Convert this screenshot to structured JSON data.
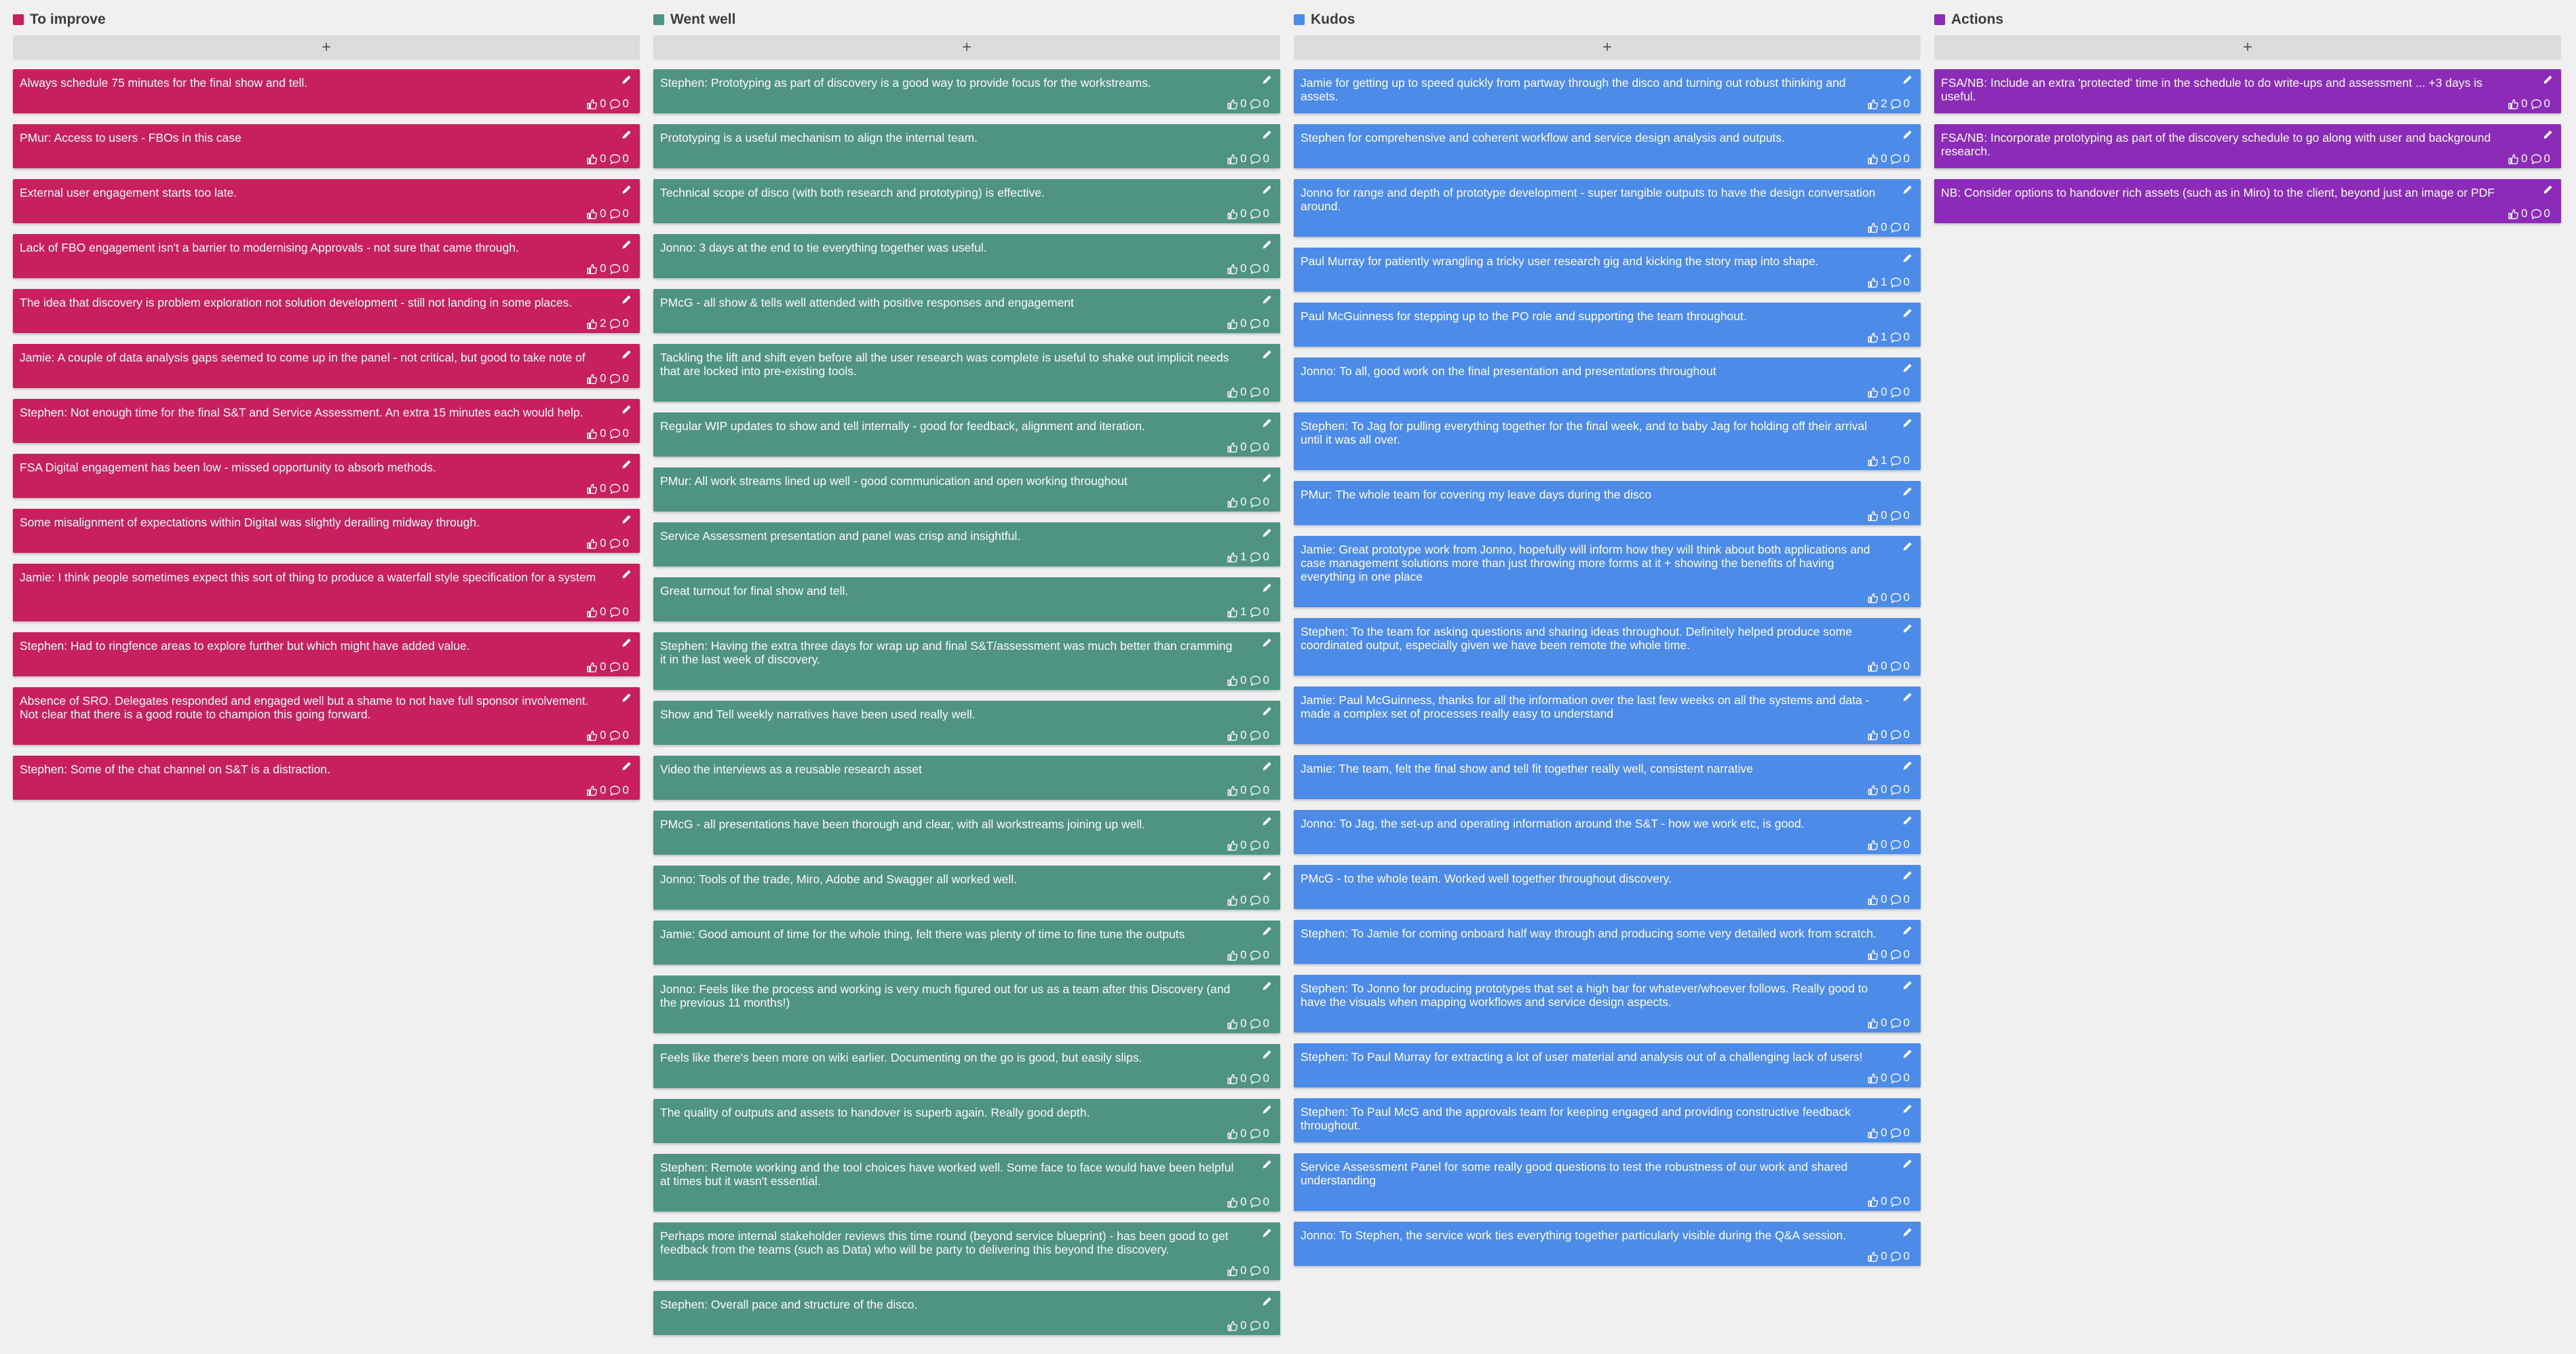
{
  "colors": {
    "background": "#f0f0f0",
    "add_button": "#dcdcdc"
  },
  "add_label": "+",
  "columns": [
    {
      "title": "To improve",
      "color": "#c8205c",
      "cards": [
        {
          "text": "Always schedule 75 minutes for the final show and tell.",
          "likes": "0",
          "comments": "0"
        },
        {
          "text": "PMur: Access to users - FBOs in this case",
          "likes": "0",
          "comments": "0"
        },
        {
          "text": "External user engagement starts too late.",
          "likes": "0",
          "comments": "0"
        },
        {
          "text": "Lack of FBO engagement isn't a barrier to modernising Approvals - not sure that came through.",
          "likes": "0",
          "comments": "0"
        },
        {
          "text": "The idea that discovery is problem exploration not solution development - still not landing in some places.",
          "likes": "2",
          "comments": "0"
        },
        {
          "text": "Jamie: A couple of data analysis gaps seemed to come up in the panel - not critical, but good to take note of",
          "likes": "0",
          "comments": "0"
        },
        {
          "text": "Stephen: Not enough time for the final S&T and Service Assessment. An extra 15 minutes each would help.",
          "likes": "0",
          "comments": "0"
        },
        {
          "text": "FSA Digital engagement has been low - missed opportunity to absorb methods.",
          "likes": "0",
          "comments": "0"
        },
        {
          "text": "Some misalignment of expectations within Digital was slightly derailing midway through.",
          "likes": "0",
          "comments": "0"
        },
        {
          "text": "Jamie: I think people sometimes expect this sort of thing to produce a waterfall style specification for a system",
          "likes": "0",
          "comments": "0"
        },
        {
          "text": "Stephen: Had to ringfence areas to explore further but which might have added value.",
          "likes": "0",
          "comments": "0"
        },
        {
          "text": "Absence of SRO. Delegates responded and engaged well but a shame to not have full sponsor involvement. Not clear that there is a good route to champion this going forward.",
          "likes": "0",
          "comments": "0"
        },
        {
          "text": "Stephen: Some of the chat channel on S&T is a distraction.",
          "likes": "0",
          "comments": "0"
        }
      ]
    },
    {
      "title": "Went well",
      "color": "#4f9483",
      "cards": [
        {
          "text": "Stephen: Prototyping as part of discovery is a good way to provide focus for the workstreams.",
          "likes": "0",
          "comments": "0"
        },
        {
          "text": "Prototyping is a useful mechanism to align the internal team.",
          "likes": "0",
          "comments": "0"
        },
        {
          "text": "Technical scope of disco (with both research and prototyping) is effective.",
          "likes": "0",
          "comments": "0"
        },
        {
          "text": "Jonno: 3 days at the end to tie everything together was useful.",
          "likes": "0",
          "comments": "0"
        },
        {
          "text": "PMcG - all show & tells well attended with positive responses and engagement",
          "likes": "0",
          "comments": "0"
        },
        {
          "text": "Tackling the lift and shift even before all the user research was complete is useful to shake out implicit needs that are locked into pre-existing tools.",
          "likes": "0",
          "comments": "0"
        },
        {
          "text": "Regular WIP updates to show and tell internally - good for feedback, alignment and iteration.",
          "likes": "0",
          "comments": "0"
        },
        {
          "text": "PMur: All work streams lined up well - good communication and open working throughout",
          "likes": "0",
          "comments": "0"
        },
        {
          "text": "Service Assessment presentation and panel was crisp and insightful.",
          "likes": "1",
          "comments": "0"
        },
        {
          "text": "Great turnout for final show and tell.",
          "likes": "1",
          "comments": "0"
        },
        {
          "text": "Stephen: Having the extra three days for wrap up and final S&T/assessment was much better than cramming it in the last week of discovery.",
          "likes": "0",
          "comments": "0"
        },
        {
          "text": "Show and Tell weekly narratives have been used really well.",
          "likes": "0",
          "comments": "0"
        },
        {
          "text": "Video the interviews as a reusable research asset",
          "likes": "0",
          "comments": "0"
        },
        {
          "text": "PMcG - all presentations have been thorough and clear, with all workstreams joining up well.",
          "likes": "0",
          "comments": "0"
        },
        {
          "text": "Jonno: Tools of the trade, Miro, Adobe and Swagger all worked well.",
          "likes": "0",
          "comments": "0"
        },
        {
          "text": "Jamie: Good amount of time for the whole thing, felt there was plenty of time to fine tune the outputs",
          "likes": "0",
          "comments": "0"
        },
        {
          "text": "Jonno: Feels like the process and working is very much figured out for us as a team after this Discovery (and the previous 11 months!)",
          "likes": "0",
          "comments": "0"
        },
        {
          "text": "Feels like there's been more on wiki earlier. Documenting on the go is good, but easily slips.",
          "likes": "0",
          "comments": "0"
        },
        {
          "text": "The quality of outputs and assets to handover is superb again. Really good depth.",
          "likes": "0",
          "comments": "0"
        },
        {
          "text": "Stephen: Remote working and the tool choices have worked well. Some face to face would have been helpful at times but it wasn't essential.",
          "likes": "0",
          "comments": "0"
        },
        {
          "text": "Perhaps more internal stakeholder reviews this time round (beyond service blueprint) - has been good to get feedback from the teams (such as Data) who will be party to delivering this beyond the discovery.",
          "likes": "0",
          "comments": "0"
        },
        {
          "text": "Stephen: Overall pace and structure of the disco.",
          "likes": "0",
          "comments": "0"
        }
      ]
    },
    {
      "title": "Kudos",
      "color": "#4c8be8",
      "cards": [
        {
          "text": "Jamie for getting up to speed quickly from partway through the disco and turning out robust thinking and assets.",
          "likes": "2",
          "comments": "0"
        },
        {
          "text": "Stephen for comprehensive and coherent workflow and service design analysis and outputs.",
          "likes": "0",
          "comments": "0"
        },
        {
          "text": "Jonno for range and depth of prototype development - super tangible outputs to have the design conversation around.",
          "likes": "0",
          "comments": "0"
        },
        {
          "text": "Paul Murray for patiently wrangling a tricky user research gig and kicking the story map into shape.",
          "likes": "1",
          "comments": "0"
        },
        {
          "text": "Paul McGuinness for stepping up to the PO role and supporting the team throughout.",
          "likes": "1",
          "comments": "0"
        },
        {
          "text": "Jonno: To all, good work on the final presentation and presentations throughout",
          "likes": "0",
          "comments": "0"
        },
        {
          "text": "Stephen: To Jag for pulling everything together for the final week, and to baby Jag for holding off their arrival until it was all over.",
          "likes": "1",
          "comments": "0"
        },
        {
          "text": "PMur: The whole team for covering my leave days during the disco",
          "likes": "0",
          "comments": "0"
        },
        {
          "text": "Jamie: Great prototype work from Jonno, hopefully will inform how they will think about both applications and case management solutions more than just throwing more forms at it + showing the benefits of having everything in one place",
          "likes": "0",
          "comments": "0"
        },
        {
          "text": "Stephen: To the team for asking questions and sharing ideas throughout. Definitely helped produce some coordinated output, especially given we have been remote the whole time.",
          "likes": "0",
          "comments": "0"
        },
        {
          "text": "Jamie: Paul McGuinness, thanks for all the information over the last few weeks on all the systems and data - made a complex set of processes really easy to understand",
          "likes": "0",
          "comments": "0"
        },
        {
          "text": "Jamie: The team, felt the final show and tell fit together really well, consistent narrative",
          "likes": "0",
          "comments": "0"
        },
        {
          "text": "Jonno: To Jag, the set-up and operating information around the S&T - how we work etc, is good.",
          "likes": "0",
          "comments": "0"
        },
        {
          "text": "PMcG - to the whole team. Worked well together throughout discovery.",
          "likes": "0",
          "comments": "0"
        },
        {
          "text": "Stephen: To Jamie for coming onboard half way through and producing some very detailed work from scratch.",
          "likes": "0",
          "comments": "0"
        },
        {
          "text": "Stephen: To Jonno for producing prototypes that set a high bar for whatever/whoever follows. Really good to have the visuals when mapping workflows and service design aspects.",
          "likes": "0",
          "comments": "0"
        },
        {
          "text": "Stephen: To Paul Murray for extracting a lot of user material and analysis out of a challenging lack of users!",
          "likes": "0",
          "comments": "0"
        },
        {
          "text": "Stephen: To Paul McG and the approvals team for keeping engaged and providing constructive feedback throughout.",
          "likes": "0",
          "comments": "0"
        },
        {
          "text": "Service Assessment Panel for some really good questions to test the robustness of our work and shared understanding",
          "likes": "0",
          "comments": "0"
        },
        {
          "text": "Jonno: To Stephen, the service work ties everything together particularly visible during the Q&A session.",
          "likes": "0",
          "comments": "0"
        }
      ]
    },
    {
      "title": "Actions",
      "color": "#8c2bb8",
      "cards": [
        {
          "text": "FSA/NB: Include an extra 'protected' time in the schedule to do write-ups and assessment ... +3 days is useful.",
          "likes": "0",
          "comments": "0"
        },
        {
          "text": "FSA/NB: Incorporate prototyping as part of the discovery schedule to go along with user and background research.",
          "likes": "0",
          "comments": "0"
        },
        {
          "text": "NB: Consider options to handover rich assets (such as in Miro) to the client, beyond just an image or PDF",
          "likes": "0",
          "comments": "0"
        }
      ]
    }
  ]
}
